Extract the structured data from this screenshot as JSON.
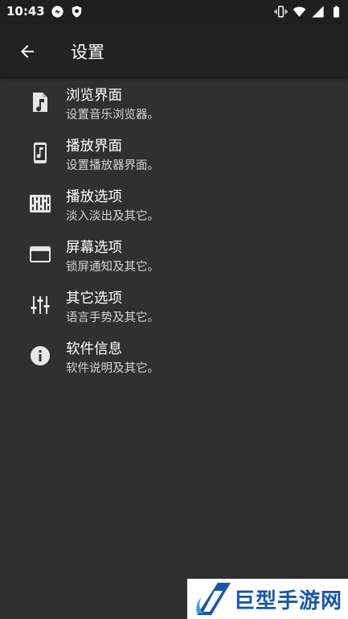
{
  "status_bar": {
    "time": "10:43",
    "left_icons": [
      "sync-icon",
      "shield-icon"
    ],
    "right_icons": [
      "vibrate-icon",
      "wifi-icon",
      "signal-icon",
      "battery-icon"
    ]
  },
  "toolbar": {
    "back_icon": "arrow-left-icon",
    "title": "设置"
  },
  "settings": [
    {
      "icon": "music-file-icon",
      "title": "浏览界面",
      "subtitle": "设置音乐浏览器。"
    },
    {
      "icon": "phone-music-icon",
      "title": "播放界面",
      "subtitle": "设置播放器界面。"
    },
    {
      "icon": "equalizer-icon",
      "title": "播放选项",
      "subtitle": "淡入淡出及其它。"
    },
    {
      "icon": "window-icon",
      "title": "屏幕选项",
      "subtitle": "锁屏通知及其它。"
    },
    {
      "icon": "sliders-icon",
      "title": "其它选项",
      "subtitle": "语言手势及其它。"
    },
    {
      "icon": "info-icon",
      "title": "软件信息",
      "subtitle": "软件说明及其它。"
    }
  ],
  "watermark": {
    "text": "巨型手游网"
  },
  "colors": {
    "background": "#303030",
    "toolbar": "#222222",
    "status_bar": "#1f1f1f",
    "icon": "#e6e6e6",
    "watermark_blue": "#1a56a8"
  }
}
